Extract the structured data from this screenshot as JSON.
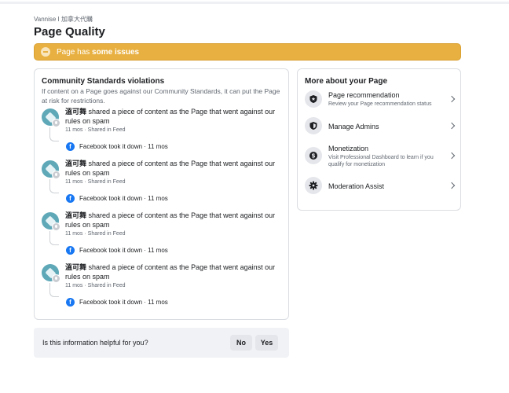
{
  "breadcrumb": "Vannise I 加拿大代購",
  "page_title": "Page Quality",
  "banner": {
    "prefix": "Page has ",
    "emphasis": "some issues",
    "color": "#e8b040"
  },
  "violations": {
    "title": "Community Standards violations",
    "description": "If content on a Page goes against our Community Standards, it can put the Page at risk for restrictions.",
    "items": [
      {
        "name": "溫可舞",
        "text": " shared a piece of content as the Page that went against our rules on spam",
        "meta": "11 mos · Shared in Feed",
        "takedown": "Facebook took it down · 11 mos"
      },
      {
        "name": "溫可舞",
        "text": " shared a piece of content as the Page that went against our rules on spam",
        "meta": "11 mos · Shared in Feed",
        "takedown": "Facebook took it down · 11 mos"
      },
      {
        "name": "溫可舞",
        "text": " shared a piece of content as the Page that went against our rules on spam",
        "meta": "11 mos · Shared in Feed",
        "takedown": "Facebook took it down · 11 mos"
      },
      {
        "name": "溫可舞",
        "text": " shared a piece of content as the Page that went against our rules on spam",
        "meta": "11 mos · Shared in Feed",
        "takedown": "Facebook took it down · 11 mos"
      }
    ]
  },
  "helpful": {
    "question": "Is this information helpful for you?",
    "no_label": "No",
    "yes_label": "Yes"
  },
  "more": {
    "title": "More about your Page",
    "items": [
      {
        "icon": "shield-star-icon",
        "label": "Page recommendation",
        "sub": "Review your Page recommendation status"
      },
      {
        "icon": "shield-icon",
        "label": "Manage Admins",
        "sub": ""
      },
      {
        "icon": "dollar-icon",
        "label": "Monetization",
        "sub": "Visit Professional Dashboard to learn if you qualify for monetization"
      },
      {
        "icon": "gear-icon",
        "label": "Moderation Assist",
        "sub": ""
      }
    ]
  },
  "colors": {
    "accent": "#1877f2",
    "warning": "#e8b040"
  }
}
